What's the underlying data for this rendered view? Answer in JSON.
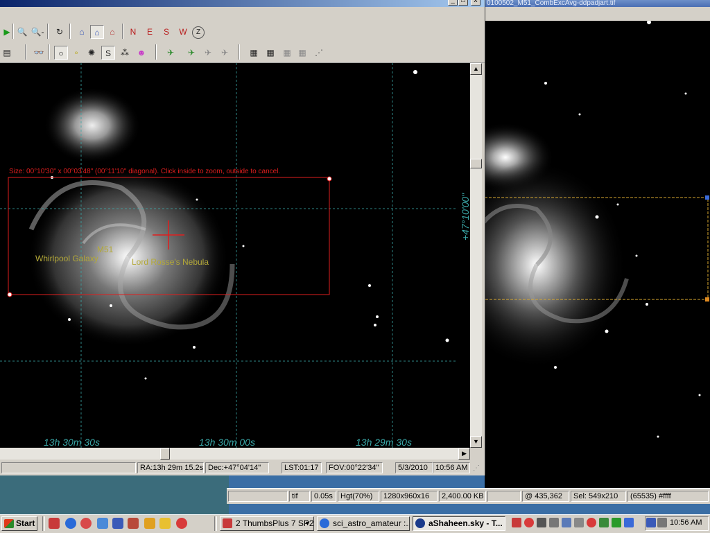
{
  "viewer": {
    "title": "0100502_M51_CombExcAvg-ddpadjart.tif",
    "status": {
      "format": "tif",
      "time": "0.05s",
      "fit": "Hgt(70%)",
      "dimensions": "1280x960x16",
      "size": "2,400.00 KB",
      "blank": "",
      "cursor": "@ 435,362",
      "selection": "Sel: 549x210",
      "pixel": "(65535) #ffff"
    }
  },
  "sky": {
    "window_buttons": [
      "_",
      "□",
      "x"
    ],
    "chart": {
      "selection_hint": "Size: 00°10'30\" x 00°03'48\"  (00°11'10\" diagonal). Click inside to zoom, outside to cancel.",
      "labels": {
        "m51": "M51",
        "whirlpool": "Whirlpool Galaxy",
        "lord_rosse": "Lord Rosse's Nebula"
      },
      "ra_ticks": [
        "13h 30m 30s",
        "13h 30m 00s",
        "13h 29m 30s"
      ],
      "dec_tick": "+47°10'00\""
    },
    "status": {
      "blank": "",
      "ra": "RA:13h 29m 15.2s",
      "dec": "Dec:+47°04'14\"",
      "lst": "LST:01:17",
      "fov": "FOV:00°22'34\"",
      "date": "5/3/2010",
      "time": "10:56 AM"
    },
    "toolbar1": [
      "▶",
      "🔍+",
      "🔍-",
      "↻",
      "⌂",
      "⌂",
      "⌂",
      "N",
      "E",
      "S",
      "W",
      "Z"
    ],
    "toolbar2": [
      "▤",
      "👓",
      "○",
      "∘",
      "✺",
      "S",
      "⁂",
      "☻",
      "✈",
      "✈",
      "✈",
      "✈",
      "▦",
      "▦",
      "▦",
      "▦",
      "⋰"
    ]
  },
  "taskbar": {
    "start_label": "Start",
    "tasks": [
      {
        "label": "2 ThumbsPlus 7 SP2",
        "dropdown": true
      },
      {
        "label": "sci_astro_amateur :...",
        "dropdown": false
      },
      {
        "label": "aShaheen.sky - T...",
        "dropdown": false
      }
    ],
    "clock": "10:56 AM"
  },
  "colors": {
    "selection_red": "#e01e1e",
    "label_olive": "#b3a838",
    "grid_teal": "#3aa8a8",
    "accent_gold": "#d8a830"
  }
}
